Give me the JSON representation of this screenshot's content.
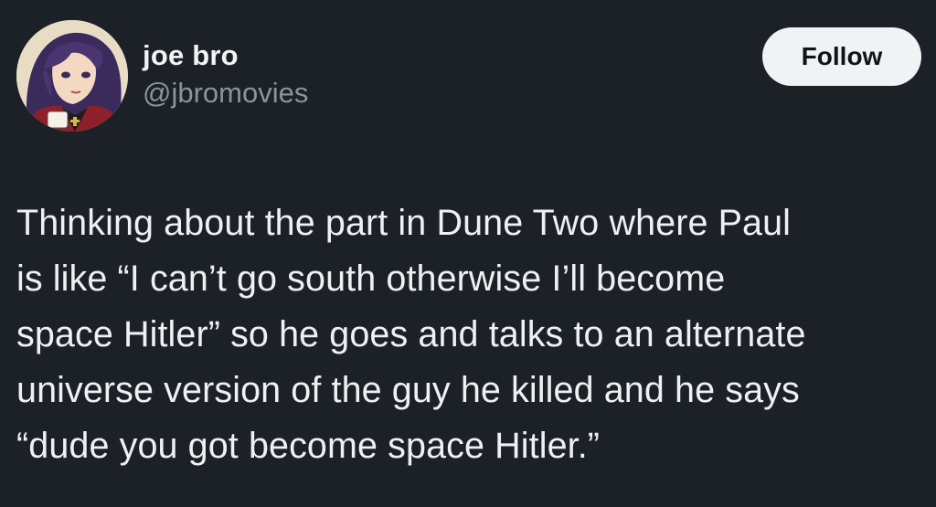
{
  "author": {
    "display_name": "joe bro",
    "handle": "@jbromovies",
    "avatar_icon": "anime-avatar"
  },
  "actions": {
    "follow_label": "Follow"
  },
  "tweet": {
    "lines": [
      "Thinking about the part in Dune Two where Paul",
      "is like “I can’t go south otherwise I’ll become",
      "space Hitler” so he goes and talks to an alternate",
      "universe version of the guy he killed and he says",
      "“dude you got become space Hitler.”"
    ]
  },
  "colors": {
    "background": "#1c2128",
    "text": "#e7e9ea",
    "secondary_text": "#8b949e",
    "button_bg": "#eff3f4",
    "button_text": "#0f1419"
  }
}
